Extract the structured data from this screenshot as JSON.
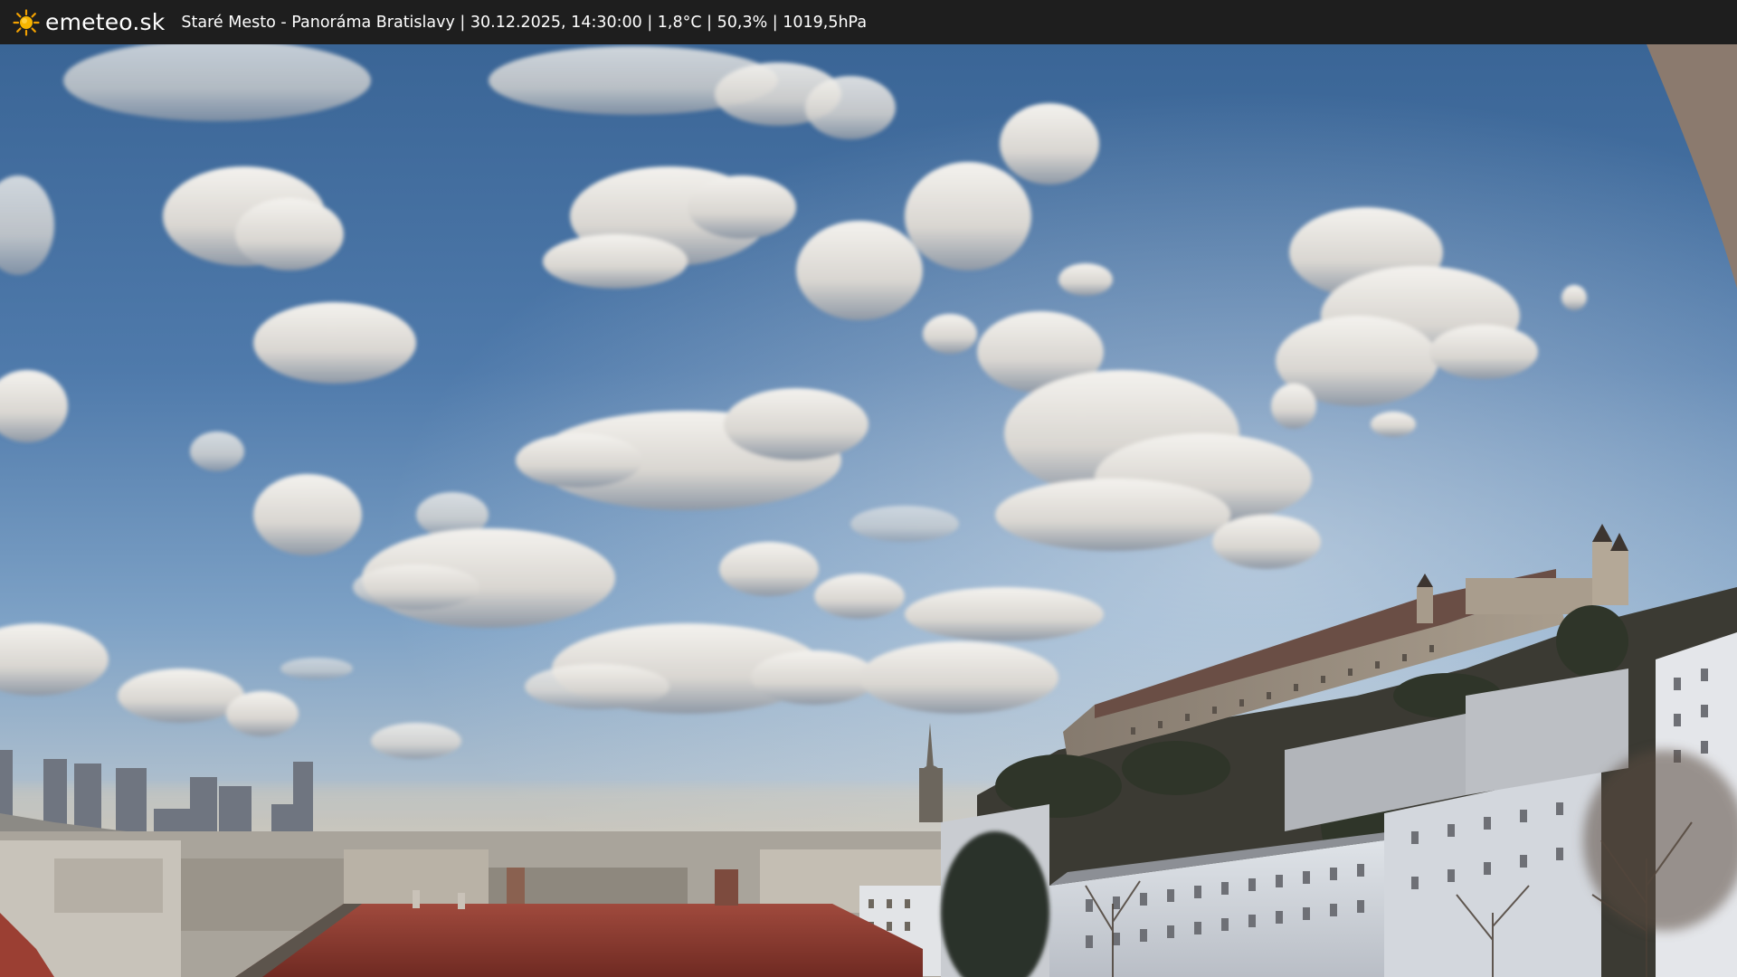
{
  "header": {
    "logo_icon": "sun-icon",
    "logo_text": "emeteo.sk",
    "station_info": "Staré Mesto - Panoráma Bratislavy | 30.12.2025, 14:30:00 | 1,8°C | 50,3% | 1019,5hPa"
  },
  "webcam": {
    "scene": "webcam-panorama",
    "colors": {
      "sky_top": "#3f6a9c",
      "sky_mid": "#6d95bf",
      "sky_horizon": "#c9c3b6",
      "roof_red": "#8e3a30",
      "castle_wall": "#9b8f80",
      "building_light": "#d9dde3",
      "header_bg": "#1e1e1e"
    }
  }
}
